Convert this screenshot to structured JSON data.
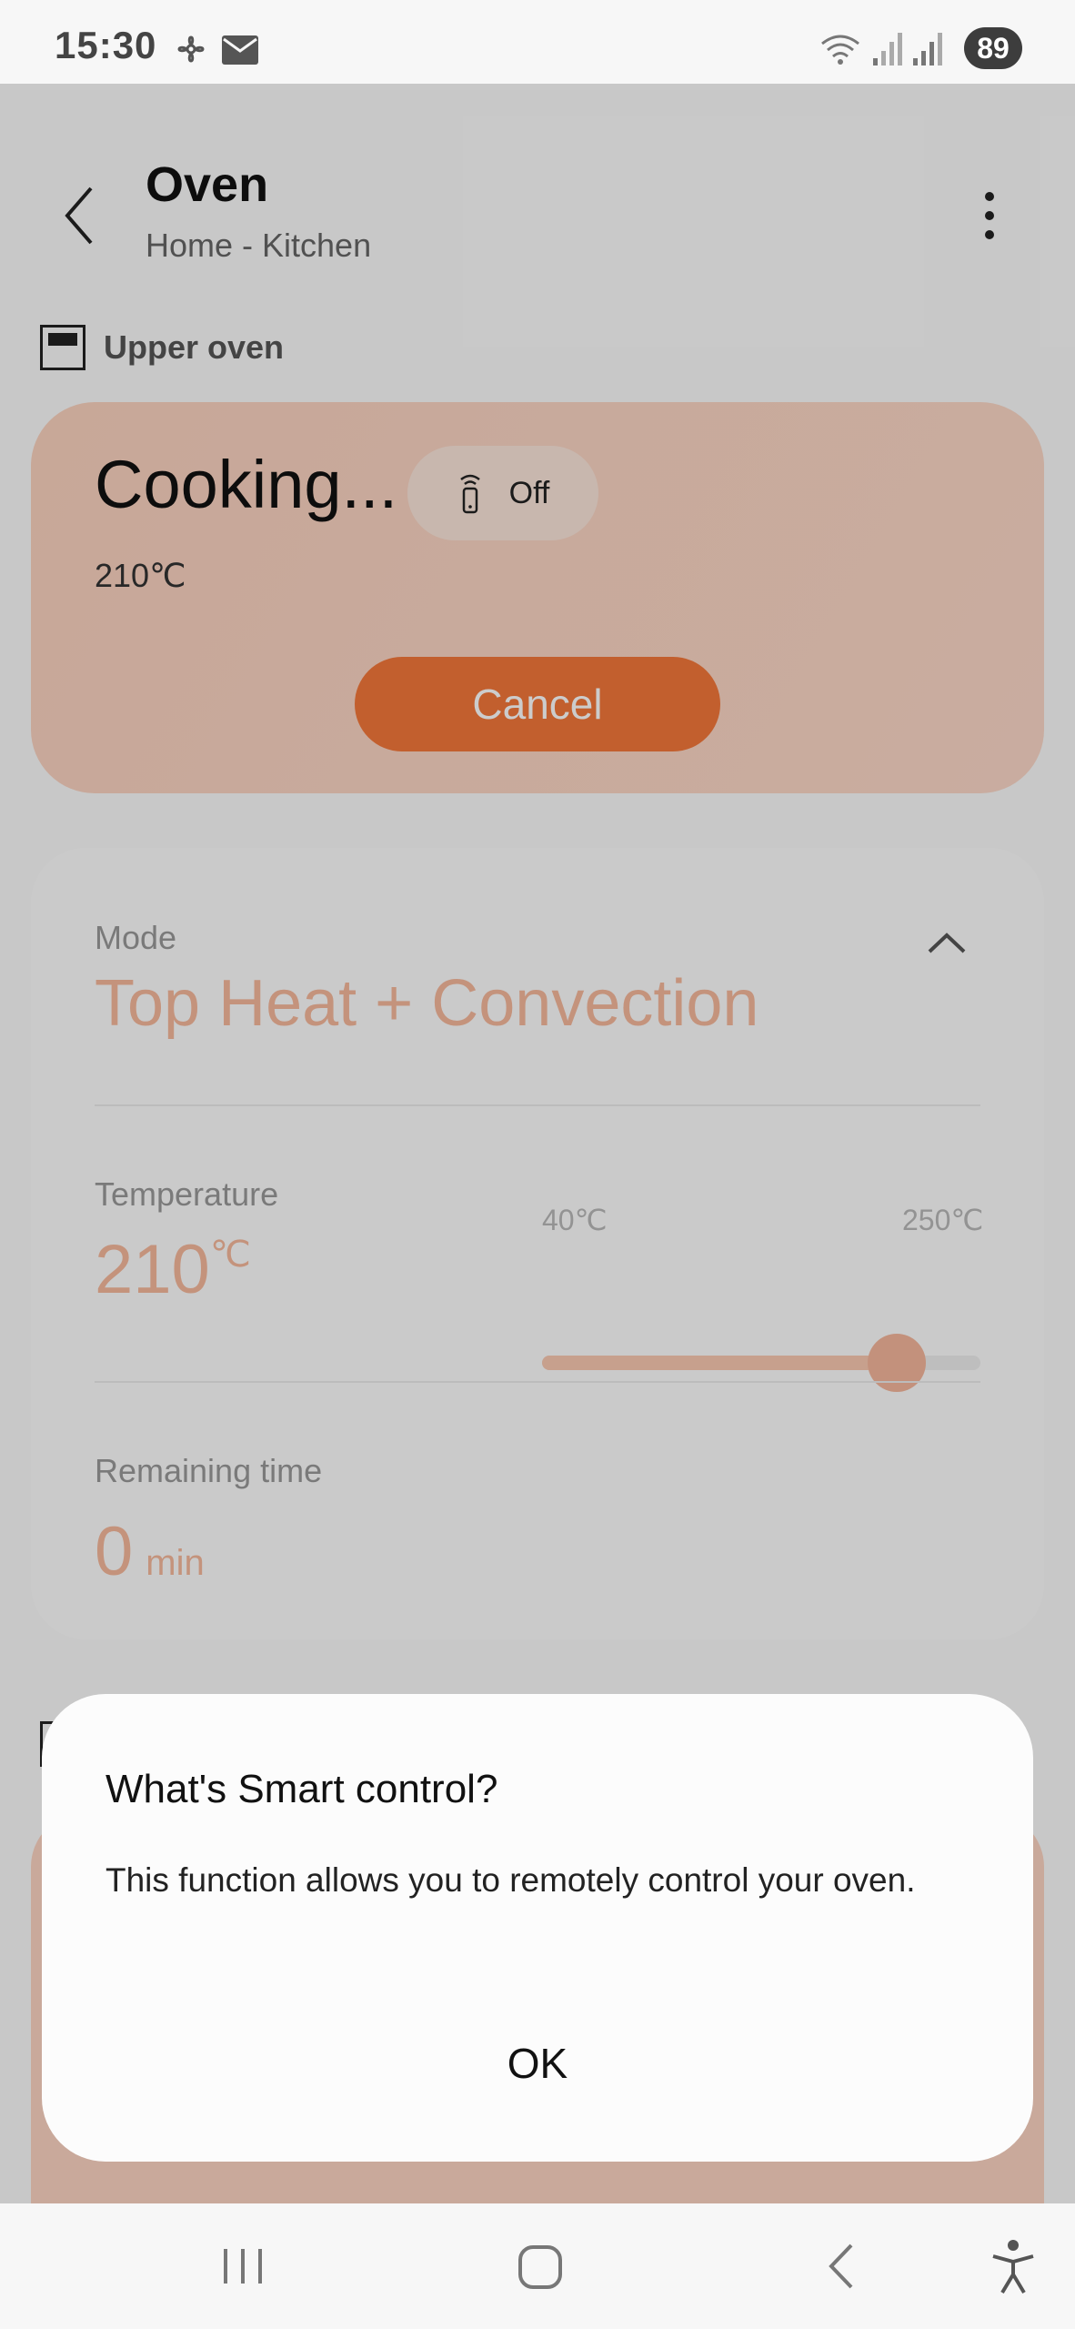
{
  "status_bar": {
    "time": "15:30",
    "battery": "89",
    "icons": [
      "fan-icon",
      "mail-icon",
      "wifi-icon",
      "signal-icon",
      "signal-icon"
    ]
  },
  "header": {
    "title": "Oven",
    "subtitle": "Home - Kitchen",
    "back_icon": "chevron-left-icon",
    "more_icon": "more-vertical-icon"
  },
  "section": {
    "label": "Upper oven",
    "icon": "oven-icon"
  },
  "status_card": {
    "state": "Cooking...",
    "smart_control_label": "Off",
    "smart_control_icon": "remote-phone-icon",
    "temperature": "210℃",
    "cancel_label": "Cancel",
    "accent_color": "#f3773a"
  },
  "settings": {
    "mode_label": "Mode",
    "mode_value": "Top Heat + Convection",
    "temperature_label": "Temperature",
    "temperature_value": "210",
    "temperature_unit": "℃",
    "slider_min": "40℃",
    "slider_max": "250℃",
    "slider_min_value": 40,
    "slider_max_value": 250,
    "slider_value": 210,
    "remaining_label": "Remaining time",
    "remaining_value": "0",
    "remaining_unit": "min"
  },
  "dialog": {
    "title": "What's Smart control?",
    "body": "This function allows you to remotely control your oven.",
    "ok_label": "OK"
  },
  "nav_bar": {
    "icons": [
      "recent-apps-icon",
      "home-icon",
      "back-icon",
      "accessibility-icon"
    ]
  }
}
